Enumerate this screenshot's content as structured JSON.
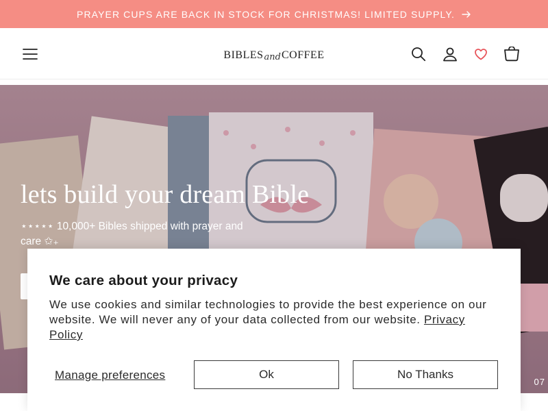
{
  "announcement": {
    "text": "PRAYER CUPS ARE BACK IN STOCK FOR CHRISTMAS! LIMITED SUPPLY.",
    "arrow_icon": "arrow-right-icon",
    "background": "#f58d84"
  },
  "header": {
    "logo": {
      "left": "BIBLES",
      "middle": "and",
      "right": "COFFEE"
    },
    "icons": {
      "menu": "hamburger-menu-icon",
      "search": "search-icon",
      "account": "account-icon",
      "wishlist": "heart-icon",
      "cart": "cart-icon"
    },
    "accent": "#e8545a"
  },
  "hero": {
    "title": "lets build your dream Bible",
    "subtitle": "⋆⋆⋆⋆⋆ 10,000+ Bibles shipped with prayer and care ✩₊",
    "slide_counter": "07"
  },
  "cookie_banner": {
    "title": "We care about your privacy",
    "body": "We use cookies and similar technologies to provide the best experience on our website. We will never any of your data collected from our website.",
    "policy_link": "Privacy Policy",
    "manage_label": "Manage preferences",
    "ok_label": "Ok",
    "no_thanks_label": "No Thanks"
  }
}
